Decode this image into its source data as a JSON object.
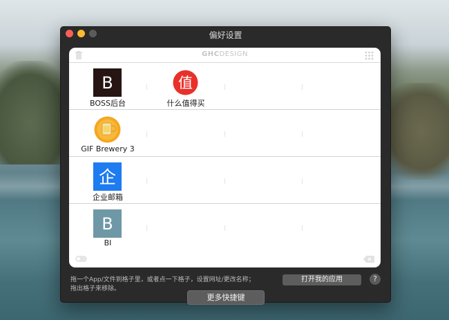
{
  "window": {
    "title": "偏好设置"
  },
  "panel": {
    "brand": {
      "bold": "GHC",
      "rest": "DESIGN"
    },
    "rows": [
      {
        "apps": [
          {
            "label": "BOSS后台",
            "icon": "boss-icon"
          },
          {
            "label": "什么值得买",
            "icon": "smzdm-icon"
          }
        ]
      },
      {
        "apps": [
          {
            "label": "GIF Brewery 3",
            "icon": "gif-brewery-icon"
          }
        ]
      },
      {
        "apps": [
          {
            "label": "企业邮箱",
            "icon": "enterprise-mail-icon"
          }
        ]
      },
      {
        "apps": [
          {
            "label": "BI",
            "icon": "bi-icon"
          }
        ]
      }
    ],
    "icon_glyphs": {
      "boss": "B",
      "smzdm": "值",
      "mail": "企",
      "bi": "B"
    }
  },
  "footer": {
    "hint": "拖一个App/文件到格子里，或者点一下格子，设置网址/更改名称；拖出格子来移除。",
    "open_apps_label": "打开我的应用",
    "help_label": "?",
    "more_shortcuts_label": "更多快捷键"
  },
  "colors": {
    "boss_bg": "#261513",
    "smzdm_red": "#e8312a",
    "gif_orange": "#f5a623",
    "mail_blue": "#1e7bf0",
    "bi_bg": "#6e98a6"
  }
}
